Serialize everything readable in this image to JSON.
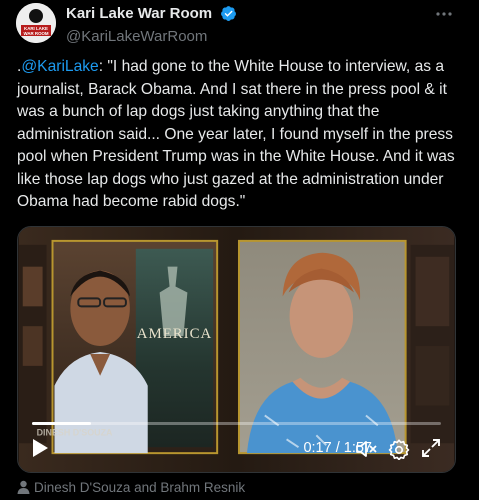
{
  "author": {
    "display_name": "Kari Lake War Room",
    "handle": "@KariLakeWarRoom",
    "avatar_text_top": "KARI LAKE",
    "avatar_text_bottom": "WAR ROOM"
  },
  "tweet": {
    "prefix": ".",
    "mention": "@KariLake",
    "body": ": \"I had gone to the White House to interview, as a journalist, Barack Obama. And I sat there in the press pool & it was a bunch of lap dogs just taking anything that the administration said... One year later, I found myself in the press pool when President Trump was in the White House. And it was like those lap dogs who just gazed at the administration under Obama had become rabid dogs.\""
  },
  "video": {
    "poster_word": "AMERICA",
    "watermark": "DINESH D'SOUZA",
    "time": "0:17 / 1:57",
    "progress": 0.145
  },
  "tagged": {
    "text": "Dinesh D'Souza and Brahm Resnik"
  },
  "icons": {
    "verified": "verified-badge-icon",
    "more": "more-icon",
    "play": "play-icon",
    "mute": "muted-speaker-icon",
    "settings": "gear-icon",
    "fullscreen": "fullscreen-icon",
    "tagged": "person-icon"
  },
  "colors": {
    "background": "#000000",
    "text": "#e7e9ea",
    "muted": "#71767b",
    "accent": "#1d9bf0",
    "frame_gold": "#b8962f"
  }
}
